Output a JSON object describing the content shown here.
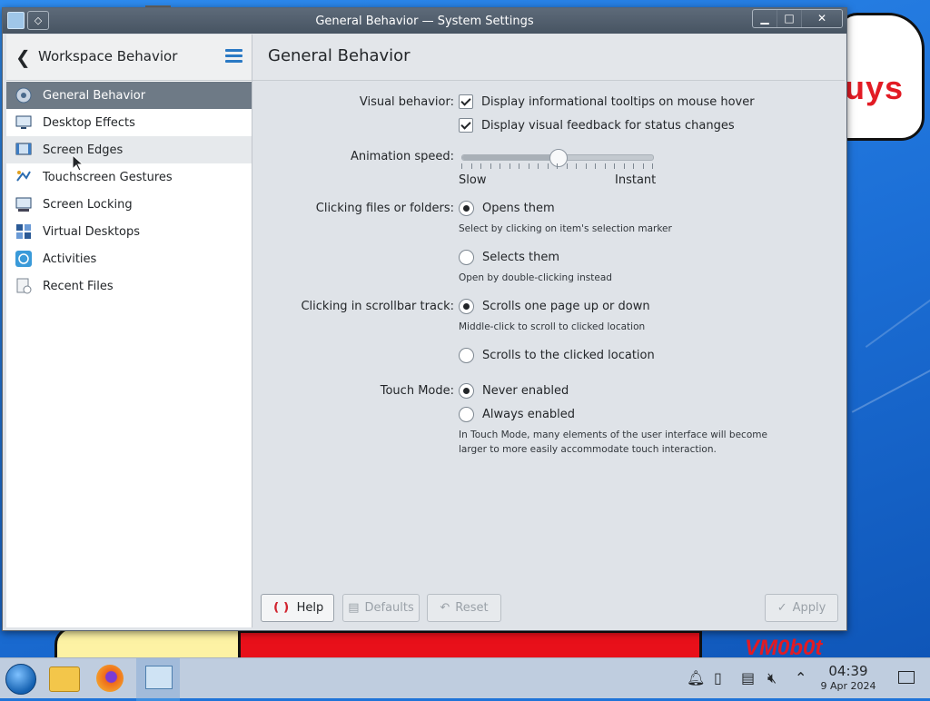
{
  "window": {
    "title": "General Behavior — System Settings",
    "pin_glyph": "◇",
    "min_glyph": "▁",
    "max_glyph": "□",
    "close_glyph": "✕"
  },
  "sidebar": {
    "back_glyph": "❮",
    "title": "Workspace Behavior",
    "items": [
      {
        "label": "General Behavior",
        "icon": "general-behavior-icon"
      },
      {
        "label": "Desktop Effects",
        "icon": "desktop-effects-icon"
      },
      {
        "label": "Screen Edges",
        "icon": "screen-edges-icon"
      },
      {
        "label": "Touchscreen Gestures",
        "icon": "touchscreen-gestures-icon"
      },
      {
        "label": "Screen Locking",
        "icon": "screen-locking-icon"
      },
      {
        "label": "Virtual Desktops",
        "icon": "virtual-desktops-icon"
      },
      {
        "label": "Activities",
        "icon": "activities-icon"
      },
      {
        "label": "Recent Files",
        "icon": "recent-files-icon"
      }
    ]
  },
  "main": {
    "title": "General Behavior",
    "visual": {
      "label": "Visual behavior:",
      "tooltips": "Display informational tooltips on mouse hover",
      "feedback": "Display visual feedback for status changes"
    },
    "animation": {
      "label": "Animation speed:",
      "min": "Slow",
      "max": "Instant",
      "value": 0.5
    },
    "clicking": {
      "label": "Clicking files or folders:",
      "opens": "Opens them",
      "opens_hint": "Select by clicking on item's selection marker",
      "selects": "Selects them",
      "selects_hint": "Open by double-clicking instead"
    },
    "scrollbar": {
      "label": "Clicking in scrollbar track:",
      "page": "Scrolls one page up or down",
      "page_hint": "Middle-click to scroll to clicked location",
      "location": "Scrolls to the clicked location"
    },
    "touch": {
      "label": "Touch Mode:",
      "never": "Never enabled",
      "always": "Always enabled",
      "hint_line1": "In Touch Mode, many elements of the user interface will become",
      "hint_line2": "larger to more easily accommodate touch interaction."
    },
    "buttons": {
      "help": "Help",
      "defaults": "Defaults",
      "reset": "Reset",
      "apply": "Apply"
    }
  },
  "desktop": {
    "cloud_text": "uys",
    "logo_text": "VM0b0t"
  },
  "taskbar": {
    "time": "04:39",
    "date": "9 Apr 2024"
  },
  "colors": {
    "accent": "#2a79c4",
    "selection": "#6e7a86"
  }
}
